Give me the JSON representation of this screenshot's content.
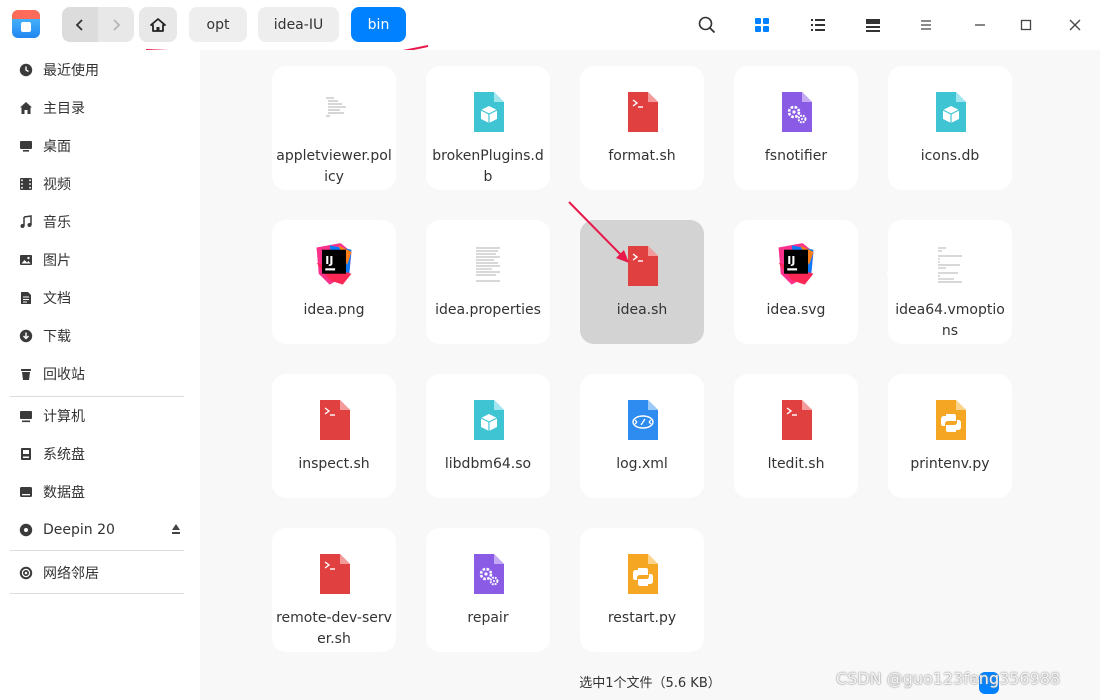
{
  "breadcrumb": [
    "opt",
    "idea-IU",
    "bin"
  ],
  "sidebar": {
    "items": [
      {
        "label": "最近使用",
        "icon": "clock-icon"
      },
      {
        "label": "主目录",
        "icon": "home-icon"
      },
      {
        "label": "桌面",
        "icon": "desktop-icon"
      },
      {
        "label": "视频",
        "icon": "video-icon"
      },
      {
        "label": "音乐",
        "icon": "music-icon"
      },
      {
        "label": "图片",
        "icon": "picture-icon"
      },
      {
        "label": "文档",
        "icon": "document-icon"
      },
      {
        "label": "下载",
        "icon": "download-icon"
      },
      {
        "label": "回收站",
        "icon": "trash-icon"
      }
    ],
    "devices": [
      {
        "label": "计算机",
        "icon": "computer-icon"
      },
      {
        "label": "系统盘",
        "icon": "disk-icon"
      },
      {
        "label": "数据盘",
        "icon": "disk-icon"
      },
      {
        "label": "Deepin 20",
        "icon": "optical-disc-icon"
      }
    ],
    "network": [
      {
        "label": "网络邻居",
        "icon": "network-icon"
      }
    ]
  },
  "files": [
    {
      "name": "appletviewer.policy",
      "type": "text"
    },
    {
      "name": "brokenPlugins.db",
      "type": "db"
    },
    {
      "name": "format.sh",
      "type": "sh"
    },
    {
      "name": "fsnotifier",
      "type": "exec"
    },
    {
      "name": "icons.db",
      "type": "db"
    },
    {
      "name": "idea.png",
      "type": "ij"
    },
    {
      "name": "idea.properties",
      "type": "text"
    },
    {
      "name": "idea.sh",
      "type": "sh",
      "selected": true
    },
    {
      "name": "idea.svg",
      "type": "ij"
    },
    {
      "name": "idea64.vmoptions",
      "type": "text"
    },
    {
      "name": "inspect.sh",
      "type": "sh"
    },
    {
      "name": "libdbm64.so",
      "type": "db"
    },
    {
      "name": "log.xml",
      "type": "xml"
    },
    {
      "name": "ltedit.sh",
      "type": "sh"
    },
    {
      "name": "printenv.py",
      "type": "py"
    },
    {
      "name": "remote-dev-server.sh",
      "type": "sh"
    },
    {
      "name": "repair",
      "type": "exec"
    },
    {
      "name": "restart.py",
      "type": "py"
    }
  ],
  "status": {
    "text": "选中1个文件（5.6 KB）"
  },
  "watermark": "CSDN @guo123feng356988",
  "colors": {
    "accent": "#0081ff",
    "annotation": "#e8184b",
    "sh": "#e14040",
    "db": "#3ec4d3",
    "exec": "#8a5ce6",
    "py": "#f5a623",
    "xml": "#2e8cf0"
  }
}
